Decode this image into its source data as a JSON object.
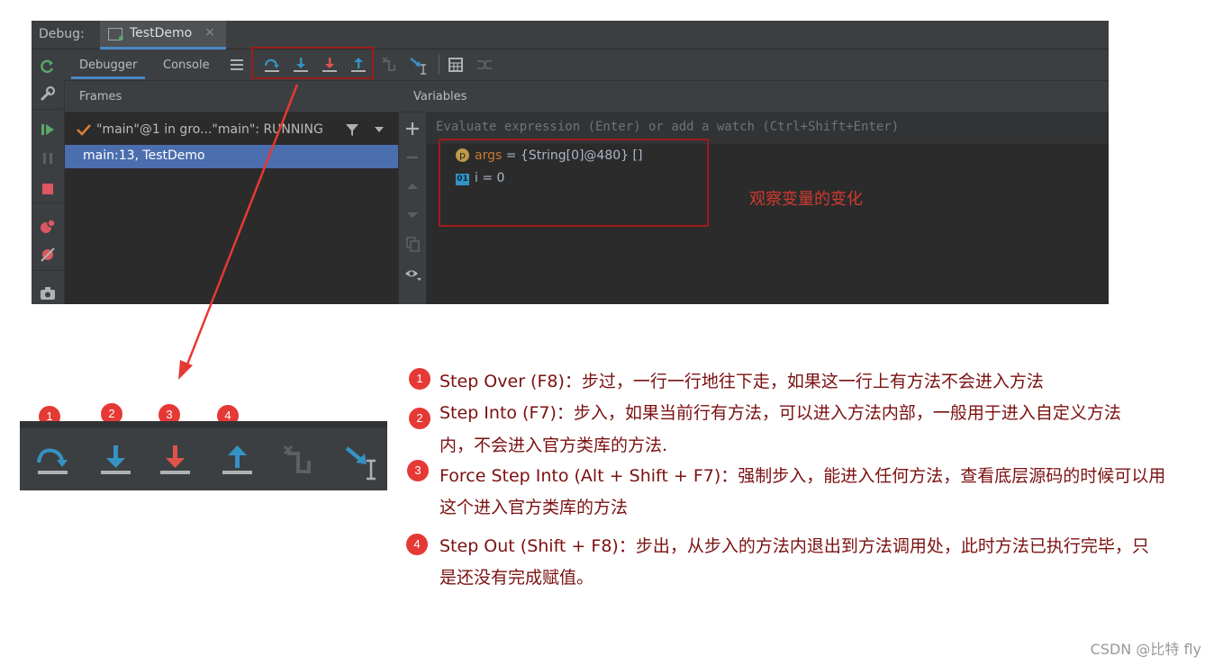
{
  "debug_panel": {
    "label": "Debug:",
    "run_tab": {
      "label": "TestDemo",
      "close": "×"
    },
    "tabs": [
      {
        "label": "Debugger"
      },
      {
        "label": "Console"
      }
    ],
    "frames": {
      "title": "Frames",
      "thread": "\"main\"@1 in gro...\"main\": RUNNING",
      "selected_frame": "main:13, TestDemo"
    },
    "variables": {
      "title": "Variables",
      "evaluate_placeholder": "Evaluate expression (Enter) or add a watch (Ctrl+Shift+Enter)",
      "items": [
        {
          "icon": "p",
          "name": "args",
          "value": " = {String[0]@480} []"
        },
        {
          "icon": "01",
          "name": "i",
          "value": " = 0"
        }
      ]
    },
    "note": "观察变量的变化"
  },
  "step_badges": [
    "1",
    "2",
    "3",
    "4"
  ],
  "explanations": [
    {
      "num": "1",
      "lines": [
        "Step Over (F8)：步过，一行一行地往下走，如果这一行上有方法不会进入方法"
      ]
    },
    {
      "num": "2",
      "lines": [
        "Step Into (F7)：步入，如果当前行有方法，可以进入方法内部，一般用于进入自定义方法",
        "内，不会进入官方类库的方法."
      ]
    },
    {
      "num": "3",
      "lines": [
        "Force Step Into (Alt + Shift + F7)：强制步入，能进入任何方法，查看底层源码的时候可以用",
        "这个进入官方类库的方法"
      ]
    },
    {
      "num": "4",
      "lines": [
        "Step Out (Shift + F8)：步出，从步入的方法内退出到方法调用处，此时方法已执行完毕，只",
        "是还没有完成赋值。"
      ]
    }
  ],
  "watermark": "CSDN @比特 fly",
  "colors": {
    "accent": "#4a88c7",
    "step_blue": "#3592c4",
    "step_red": "#e0534b",
    "badge": "#e53935",
    "highlight_box": "#9e1c1c"
  }
}
